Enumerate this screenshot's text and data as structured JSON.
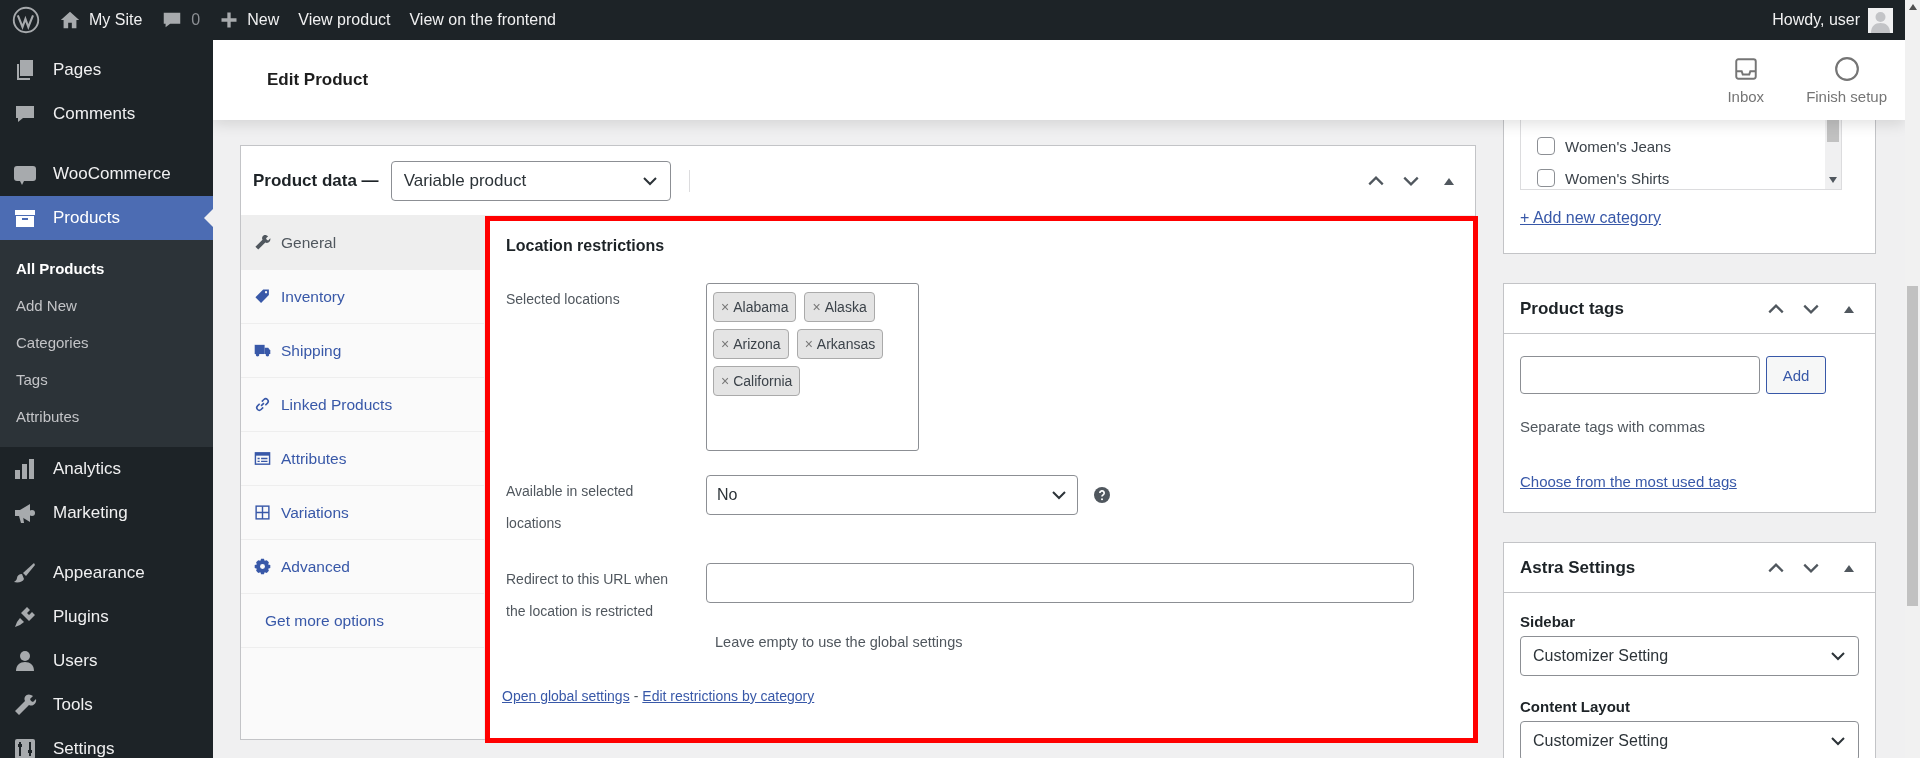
{
  "admin_bar": {
    "items": [
      {
        "kind": "logo"
      },
      {
        "kind": "home",
        "label": "My Site"
      },
      {
        "kind": "comments",
        "label": "0"
      },
      {
        "kind": "new",
        "label": "New"
      },
      {
        "kind": "link",
        "label": "View product"
      },
      {
        "kind": "link",
        "label": "View on the frontend"
      }
    ],
    "greeting": "Howdy, user"
  },
  "sidebar": {
    "groups": [
      [
        {
          "kind": "pages",
          "label": "Pages",
          "selected": false
        },
        {
          "kind": "comments",
          "label": "Comments",
          "selected": false
        }
      ],
      [
        {
          "kind": "woo",
          "label": "WooCommerce",
          "selected": false
        },
        {
          "kind": "products",
          "label": "Products",
          "selected": true,
          "children": [
            {
              "label": "All Products",
              "selected": true
            },
            {
              "label": "Add New",
              "selected": false
            },
            {
              "label": "Categories",
              "selected": false
            },
            {
              "label": "Tags",
              "selected": false
            },
            {
              "label": "Attributes",
              "selected": false
            }
          ]
        },
        {
          "kind": "analytics",
          "label": "Analytics",
          "selected": false
        },
        {
          "kind": "marketing",
          "label": "Marketing",
          "selected": false
        }
      ],
      [
        {
          "kind": "appearance",
          "label": "Appearance",
          "selected": false
        },
        {
          "kind": "plugins",
          "label": "Plugins",
          "selected": false
        },
        {
          "kind": "users",
          "label": "Users",
          "selected": false
        },
        {
          "kind": "tools",
          "label": "Tools",
          "selected": false
        },
        {
          "kind": "settings",
          "label": "Settings",
          "selected": false
        }
      ]
    ]
  },
  "header": {
    "title": "Edit Product",
    "actions": [
      {
        "kind": "inbox",
        "label": "Inbox"
      },
      {
        "kind": "finish",
        "label": "Finish setup"
      }
    ]
  },
  "product_data": {
    "title": "Product data —",
    "product_type": "Variable product",
    "tabs": [
      {
        "kind": "wrench",
        "label": "General",
        "selected": true
      },
      {
        "kind": "tag",
        "label": "Inventory",
        "selected": false
      },
      {
        "kind": "truck",
        "label": "Shipping",
        "selected": false
      },
      {
        "kind": "link",
        "label": "Linked Products",
        "selected": false
      },
      {
        "kind": "list",
        "label": "Attributes",
        "selected": false
      },
      {
        "kind": "grid",
        "label": "Variations",
        "selected": false
      },
      {
        "kind": "gear",
        "label": "Advanced",
        "selected": false
      },
      {
        "kind": "more",
        "label": "Get more options",
        "selected": false
      }
    ],
    "panel": {
      "heading": "Location restrictions",
      "fields": [
        {
          "kind": "multiselect",
          "label": "Selected locations",
          "tags": [
            {
              "remove": "×",
              "label": "Alabama"
            },
            {
              "remove": "×",
              "label": "Alaska"
            },
            {
              "remove": "×",
              "label": "Arizona"
            },
            {
              "remove": "×",
              "label": "Arkansas"
            },
            {
              "remove": "×",
              "label": "California"
            }
          ]
        },
        {
          "kind": "select",
          "label": "Available in selected locations",
          "value": "No",
          "help": true
        },
        {
          "kind": "text",
          "label": "Redirect to this URL when the location is restricted",
          "description": "Leave empty to use the global settings"
        }
      ],
      "links": [
        "Open global settings",
        "Edit restrictions by category"
      ],
      "link_separator": "-"
    }
  },
  "categories_box": {
    "items": [
      {
        "label": "Women's Jeans",
        "checked": false
      },
      {
        "label": "Women's Shirts",
        "checked": false
      }
    ],
    "add_link": "+ Add new category"
  },
  "product_tags": {
    "title": "Product tags",
    "button": "Add",
    "hint": "Separate tags with commas",
    "link": "Choose from the most used tags"
  },
  "astra_settings": {
    "title": "Astra Settings",
    "fields": [
      {
        "label": "Sidebar",
        "value": "Customizer Setting"
      },
      {
        "label": "Content Layout",
        "value": "Customizer Setting"
      }
    ]
  }
}
